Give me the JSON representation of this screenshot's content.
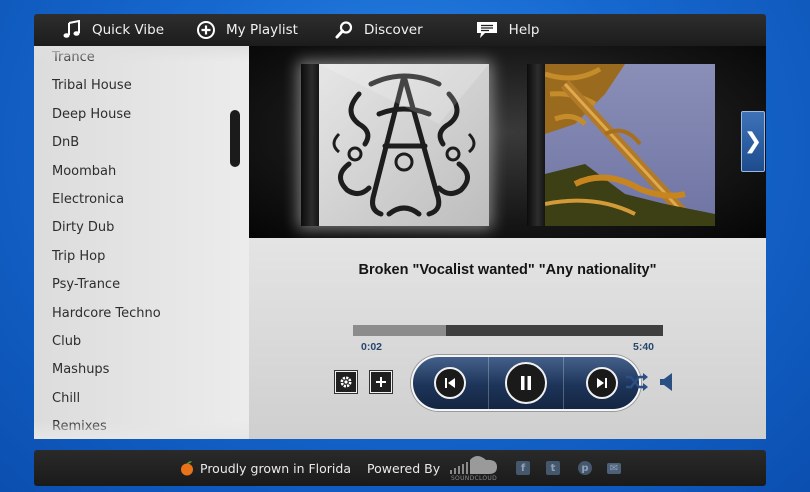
{
  "nav": {
    "items": [
      {
        "label": "Quick Vibe",
        "icon": "music-note-icon"
      },
      {
        "label": "My Playlist",
        "icon": "plus-circle-icon"
      },
      {
        "label": "Discover",
        "icon": "search-icon"
      },
      {
        "label": "Help",
        "icon": "speech-bubble-icon"
      }
    ]
  },
  "sidebar": {
    "genres": [
      "Trance",
      "Tribal House",
      "Deep House",
      "DnB",
      "Moombah",
      "Electronica",
      "Dirty Dub",
      "Trip Hop",
      "Psy-Trance",
      "Hardcore Techno",
      "Club",
      "Mashups",
      "Chill",
      "Remixes"
    ]
  },
  "covers": {
    "items": [
      {
        "art": "ornate-monogram-cover"
      },
      {
        "art": "palm-tree-cover"
      }
    ],
    "next_symbol": "❯"
  },
  "player": {
    "track_title": "Broken \"Vocalist wanted\" \"Any nationality\"",
    "elapsed": "0:02",
    "total": "5:40",
    "progress_fraction": 0.3,
    "icons": [
      "gear-icon",
      "plus-icon",
      "previous-icon",
      "pause-icon",
      "next-icon",
      "shuffle-icon",
      "volume-icon"
    ]
  },
  "footer": {
    "grown_text": "Proudly grown in Florida",
    "powered_text": "Powered By",
    "soundcloud_text": "SOUNDCLOUD",
    "social": [
      "facebook-icon",
      "twitter-icon",
      "pinterest-icon",
      "mail-icon"
    ]
  },
  "colors": {
    "accent": "#1e4c8e",
    "time_text": "#25476e"
  }
}
